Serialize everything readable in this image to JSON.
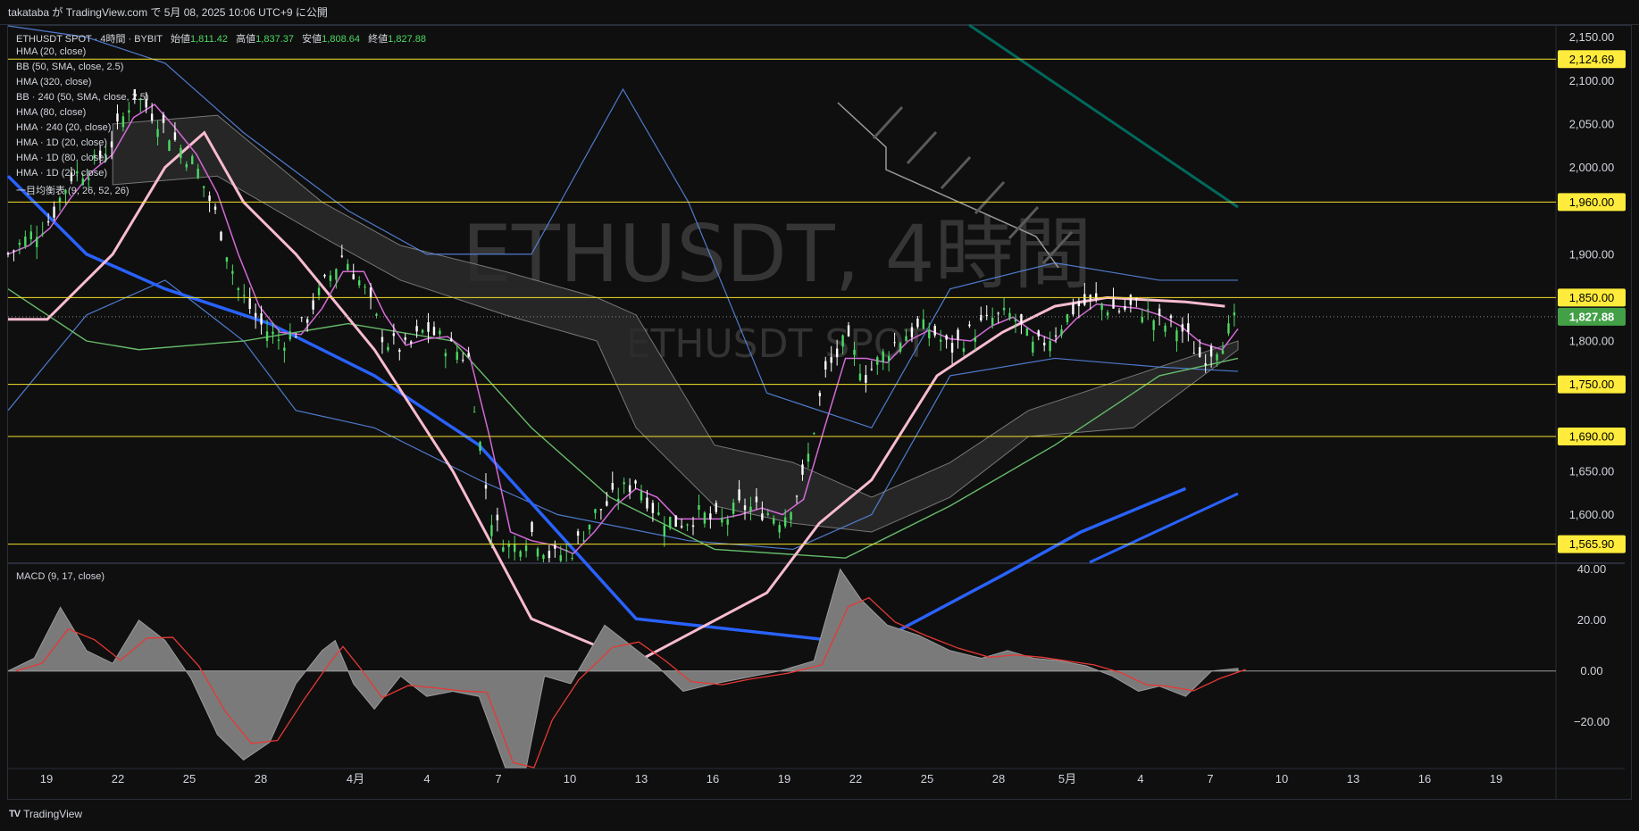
{
  "header": {
    "publish_text": "takataba が TradingView.com で 5月 08, 2025 10:06 UTC+9 に公開"
  },
  "legend": {
    "symbol": "ETHUSDT SPOT · 4時間 · BYBIT",
    "open_label": "始値",
    "open": "1,811.42",
    "high_label": "高値",
    "high": "1,837.37",
    "low_label": "安値",
    "low": "1,808.64",
    "close_label": "終値",
    "close": "1,827.88",
    "indicators": [
      "HMA (20, close)",
      "BB (50, SMA, close, 2.5)",
      "HMA (320, close)",
      "BB · 240 (50, SMA, close, 2.5)",
      "HMA (80, close)",
      "HMA · 240 (20, close)",
      "HMA · 1D (20, close)",
      "HMA · 1D (80, close)",
      "HMA · 1D (20, close)",
      "一目均衡表 (9, 26, 52, 26)"
    ]
  },
  "watermark": {
    "title": "ETHUSDT, 4時間",
    "subtitle": "ETHUSDT SPOT"
  },
  "colors": {
    "up": "#4cd964",
    "down": "#ffffff",
    "level_line": "#f5e12a",
    "level_badge": "#ffeb3b",
    "price_badge": "#43a047",
    "hma_pink": "#f8bbd0",
    "hma_magenta": "#d36ad6",
    "hma_blue": "#2962ff",
    "bb_blue": "#5b8def",
    "green_ma": "#66bb6a",
    "teal_line": "#00695c",
    "macd_red": "#e53935",
    "macd_hist": "#7a7a7a"
  },
  "macd_label": "MACD (9, 17, close)",
  "footer": {
    "logo": "TradingView"
  },
  "chart_data": {
    "type": "candlestick",
    "symbol": "ETHUSDT SPOT",
    "timeframe": "4時間",
    "exchange": "BYBIT",
    "y_axis": {
      "ylim": [
        1545,
        2163
      ],
      "ticks": [
        1600,
        1650,
        1700,
        1750,
        1800,
        1850,
        1900,
        1950,
        2000,
        2050,
        2100,
        2150
      ],
      "tick_labels": [
        "1,600.00",
        "1,650.00",
        "1,700.00",
        "1,750.00",
        "1,800.00",
        "1,850.00",
        "1,900.00",
        "1,950.00",
        "2,000.00",
        "2,050.00",
        "2,100.00",
        "2,150.00"
      ]
    },
    "x_axis": {
      "labels": [
        "19",
        "22",
        "25",
        "28",
        "4月",
        "4",
        "7",
        "10",
        "13",
        "16",
        "19",
        "22",
        "25",
        "28",
        "5月",
        "4",
        "7",
        "10",
        "13",
        "16",
        "19"
      ]
    },
    "horizontal_levels": [
      {
        "value": 2124.69,
        "label": "2,124.69"
      },
      {
        "value": 1960,
        "label": "1,960.00"
      },
      {
        "value": 1850,
        "label": "1,850.00"
      },
      {
        "value": 1750,
        "label": "1,750.00"
      },
      {
        "value": 1690,
        "label": "1,690.00"
      },
      {
        "value": 1565.9,
        "label": "1,565.90"
      }
    ],
    "current_price": {
      "value": 1827.88,
      "label": "1,827.88"
    },
    "candles_hourly_close_path": [
      [
        0,
        1900
      ],
      [
        8,
        1920
      ],
      [
        16,
        1940
      ],
      [
        24,
        1990
      ],
      [
        32,
        2000
      ],
      [
        40,
        2030
      ],
      [
        48,
        2085
      ],
      [
        56,
        2060
      ],
      [
        64,
        2030
      ],
      [
        72,
        2000
      ],
      [
        80,
        1940
      ],
      [
        88,
        1860
      ],
      [
        96,
        1820
      ],
      [
        104,
        1800
      ],
      [
        112,
        1815
      ],
      [
        120,
        1860
      ],
      [
        128,
        1900
      ],
      [
        136,
        1860
      ],
      [
        144,
        1800
      ],
      [
        152,
        1790
      ],
      [
        160,
        1815
      ],
      [
        168,
        1795
      ],
      [
        176,
        1780
      ],
      [
        184,
        1600
      ],
      [
        192,
        1560
      ],
      [
        200,
        1580
      ],
      [
        208,
        1550
      ],
      [
        216,
        1560
      ],
      [
        224,
        1600
      ],
      [
        232,
        1620
      ],
      [
        240,
        1640
      ],
      [
        248,
        1600
      ],
      [
        256,
        1590
      ],
      [
        264,
        1600
      ],
      [
        272,
        1590
      ],
      [
        280,
        1610
      ],
      [
        288,
        1605
      ],
      [
        296,
        1595
      ],
      [
        304,
        1640
      ],
      [
        312,
        1760
      ],
      [
        320,
        1800
      ],
      [
        328,
        1760
      ],
      [
        336,
        1790
      ],
      [
        344,
        1810
      ],
      [
        352,
        1815
      ],
      [
        360,
        1790
      ],
      [
        368,
        1810
      ],
      [
        376,
        1825
      ],
      [
        384,
        1830
      ],
      [
        392,
        1790
      ],
      [
        400,
        1810
      ],
      [
        408,
        1840
      ],
      [
        416,
        1845
      ],
      [
        424,
        1835
      ],
      [
        432,
        1840
      ],
      [
        440,
        1820
      ],
      [
        448,
        1815
      ],
      [
        456,
        1780
      ],
      [
        464,
        1800
      ],
      [
        470,
        1827.88
      ]
    ],
    "macd": {
      "label": "MACD (9, 17, close)",
      "ylim": [
        -38,
        42
      ],
      "ticks": [
        40,
        20,
        0,
        -20
      ],
      "tick_labels": [
        "40.00",
        "20.00",
        "0.00",
        "−20.00"
      ],
      "hist_path": [
        [
          0,
          0
        ],
        [
          10,
          5
        ],
        [
          20,
          25
        ],
        [
          30,
          8
        ],
        [
          40,
          3
        ],
        [
          50,
          20
        ],
        [
          60,
          12
        ],
        [
          70,
          -3
        ],
        [
          80,
          -25
        ],
        [
          90,
          -35
        ],
        [
          100,
          -28
        ],
        [
          110,
          -5
        ],
        [
          120,
          8
        ],
        [
          125,
          12
        ],
        [
          132,
          -5
        ],
        [
          140,
          -15
        ],
        [
          150,
          -2
        ],
        [
          160,
          -10
        ],
        [
          170,
          -8
        ],
        [
          180,
          -10
        ],
        [
          190,
          -55
        ],
        [
          198,
          -60
        ],
        [
          205,
          -2
        ],
        [
          215,
          -5
        ],
        [
          228,
          18
        ],
        [
          238,
          10
        ],
        [
          248,
          2
        ],
        [
          258,
          -8
        ],
        [
          270,
          -5
        ],
        [
          280,
          -3
        ],
        [
          295,
          0
        ],
        [
          308,
          4
        ],
        [
          318,
          40
        ],
        [
          326,
          28
        ],
        [
          336,
          18
        ],
        [
          348,
          14
        ],
        [
          360,
          8
        ],
        [
          372,
          5
        ],
        [
          382,
          8
        ],
        [
          392,
          5
        ],
        [
          402,
          4
        ],
        [
          412,
          2
        ],
        [
          422,
          -2
        ],
        [
          432,
          -8
        ],
        [
          440,
          -6
        ],
        [
          450,
          -10
        ],
        [
          460,
          0
        ],
        [
          470,
          1
        ]
      ]
    }
  }
}
